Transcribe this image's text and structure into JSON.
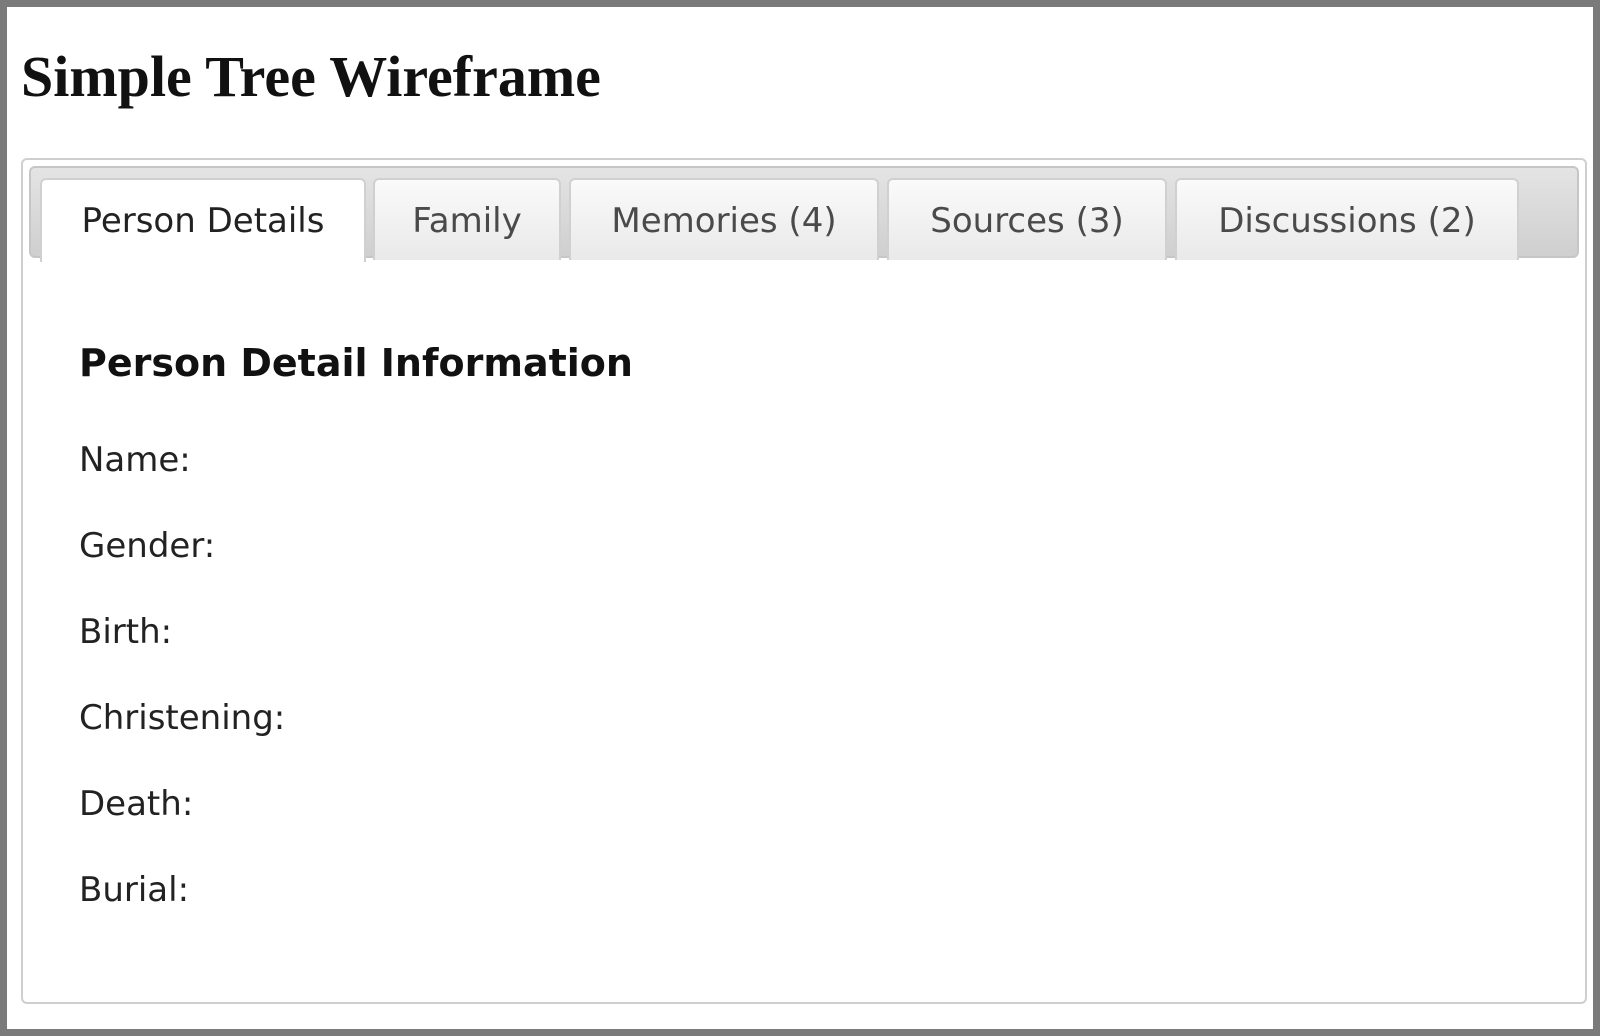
{
  "page": {
    "title": "Simple Tree Wireframe"
  },
  "tabs": [
    {
      "label": "Person Details",
      "active": true
    },
    {
      "label": "Family",
      "active": false
    },
    {
      "label": "Memories (4)",
      "active": false
    },
    {
      "label": "Sources (3)",
      "active": false
    },
    {
      "label": "Discussions (2)",
      "active": false
    }
  ],
  "details": {
    "heading": "Person Detail Information",
    "fields": [
      {
        "label": "Name:"
      },
      {
        "label": "Gender:"
      },
      {
        "label": "Birth:"
      },
      {
        "label": "Christening:"
      },
      {
        "label": "Death:"
      },
      {
        "label": "Burial:"
      }
    ]
  }
}
